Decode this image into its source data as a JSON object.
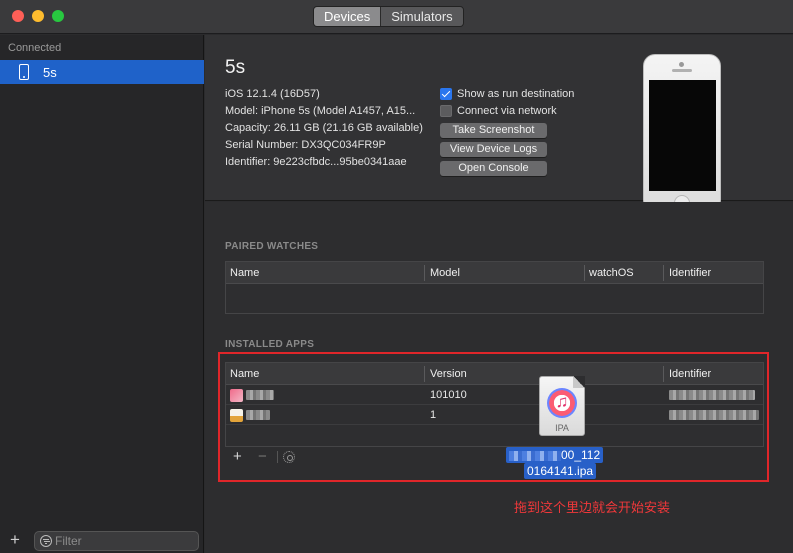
{
  "titlebar": {
    "tabs": [
      {
        "label": "Devices",
        "active": true
      },
      {
        "label": "Simulators",
        "active": false
      }
    ]
  },
  "sidebar": {
    "heading": "Connected",
    "items": [
      {
        "label": "5s",
        "icon": "iphone-icon",
        "selected": true
      }
    ],
    "filter_placeholder": "Filter"
  },
  "device": {
    "name": "5s",
    "info": [
      "iOS 12.1.4 (16D57)",
      "Model: iPhone 5s (Model A1457, A15...",
      "Capacity: 26.11 GB (21.16 GB available)",
      "Serial Number: DX3QC034FR9P",
      "Identifier: 9e223cfbdc...95be0341aae"
    ],
    "options": [
      {
        "label": "Show as run destination",
        "checked": true
      },
      {
        "label": "Connect via network",
        "checked": false
      }
    ],
    "buttons": [
      "Take Screenshot",
      "View Device Logs",
      "Open Console"
    ]
  },
  "paired_watches": {
    "title": "PAIRED WATCHES",
    "columns": [
      "Name",
      "Model",
      "watchOS",
      "Identifier"
    ]
  },
  "installed_apps": {
    "title": "INSTALLED APPS",
    "columns": [
      "Name",
      "Version",
      "Identifier"
    ],
    "rows": [
      {
        "version": "101010"
      },
      {
        "version": "1"
      }
    ]
  },
  "drag": {
    "file_type": "IPA",
    "file_name_line1": "00_112",
    "file_name_line2": "0164141.ipa"
  },
  "annotation": "拖到这个里边就会开始安装",
  "colors": {
    "selection": "#1f62c9",
    "annotation_red": "#e0262a",
    "checkbox_blue": "#2a76ee"
  }
}
